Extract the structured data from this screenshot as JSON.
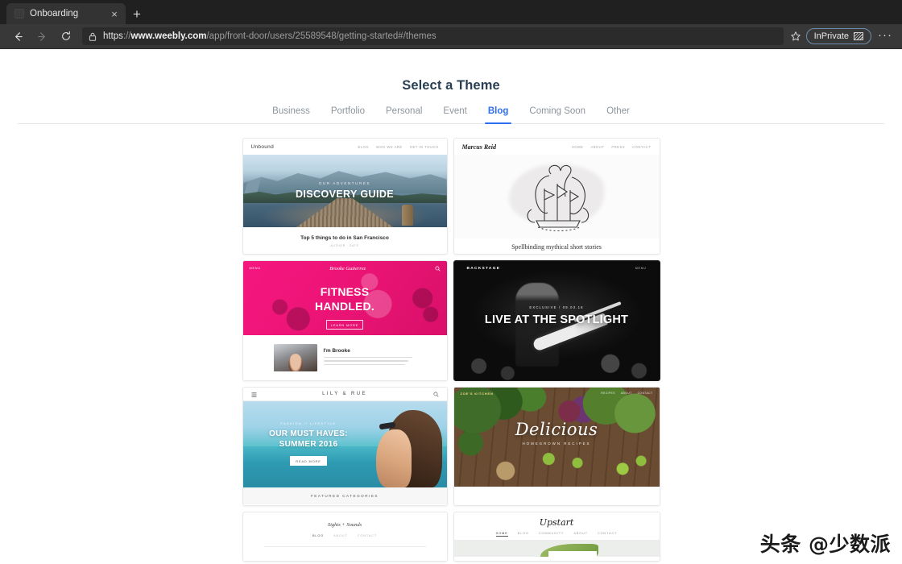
{
  "browser": {
    "tab": {
      "title": "Onboarding",
      "close_label": "×",
      "favicon": "page-favicon"
    },
    "new_tab_label": "+",
    "nav": {
      "back": "←",
      "forward": "→",
      "reload": "↻"
    },
    "url": {
      "scheme": "https",
      "separator": "://",
      "host": "www.weebly.com",
      "path": "/app/front-door/users/25589548/getting-started#/themes",
      "full": "https://www.weebly.com/app/front-door/users/25589548/getting-started#/themes"
    },
    "favorite_label": "☆",
    "inprivate_label": "InPrivate",
    "more_label": "···"
  },
  "page": {
    "title": "Select a Theme",
    "accent_color": "#2e6ff2",
    "categories": [
      {
        "label": "Business",
        "active": false
      },
      {
        "label": "Portfolio",
        "active": false
      },
      {
        "label": "Personal",
        "active": false
      },
      {
        "label": "Event",
        "active": false
      },
      {
        "label": "Blog",
        "active": true
      },
      {
        "label": "Coming Soon",
        "active": false
      },
      {
        "label": "Other",
        "active": false
      }
    ]
  },
  "themes": [
    {
      "id": "unbound",
      "brand": "Unbound",
      "nav": [
        "BLOG",
        "WHO WE ARE",
        "GET IN TOUCH"
      ],
      "hero_label": "OUR ADVENTURES",
      "hero_title": "DISCOVERY GUIDE",
      "post_title": "Top 5 things to do in San Francisco",
      "post_meta": "AUTHOR · DATE"
    },
    {
      "id": "marcus-reid",
      "brand": "Marcus Reid",
      "nav": [
        "HOME",
        "ABOUT",
        "PRESS",
        "CONTACT"
      ],
      "caption": "Spellbinding mythical short stories"
    },
    {
      "id": "brooke",
      "brand": "Brooke Gutierrez",
      "menu_label": "MENU",
      "hero_title_line1": "FITNESS",
      "hero_title_line2": "HANDLED.",
      "hero_button": "LEARN MORE",
      "bio_title": "I'm Brooke",
      "accent_color": "#ec1476"
    },
    {
      "id": "backstage",
      "brand": "BACKSTAGE",
      "nav_link": "MENU",
      "hero_label": "EXCLUSIVE / 09.03.16",
      "hero_title": "LIVE AT THE SPOTLIGHT"
    },
    {
      "id": "lily-and-rue",
      "brand": "LILY & RUE",
      "menu_icon": "hamburger-icon",
      "search_icon": "search-icon",
      "hero_label": "FASHION // LIFESTYLE",
      "hero_title_line1": "OUR MUST HAVES:",
      "hero_title_line2": "SUMMER 2016",
      "hero_button": "READ MORE",
      "footer_label": "FEATURED CATEGORIES"
    },
    {
      "id": "delicious",
      "brand": "ZOE'S KITCHEN",
      "nav": [
        "RECIPES",
        "ABOUT",
        "CONTACT"
      ],
      "hero_title": "Delicious",
      "hero_sub": "HOMEGROWN RECIPES"
    },
    {
      "id": "sights-and-sounds",
      "brand": "Sights + Sounds",
      "nav": [
        "BLOG",
        "ABOUT",
        "CONTACT"
      ]
    },
    {
      "id": "upstart",
      "brand": "Upstart",
      "nav": [
        "HOME",
        "BLOG",
        "COMMUNITY",
        "ABOUT",
        "CONTACT"
      ]
    }
  ],
  "watermark": {
    "text": "头条 @少数派"
  }
}
